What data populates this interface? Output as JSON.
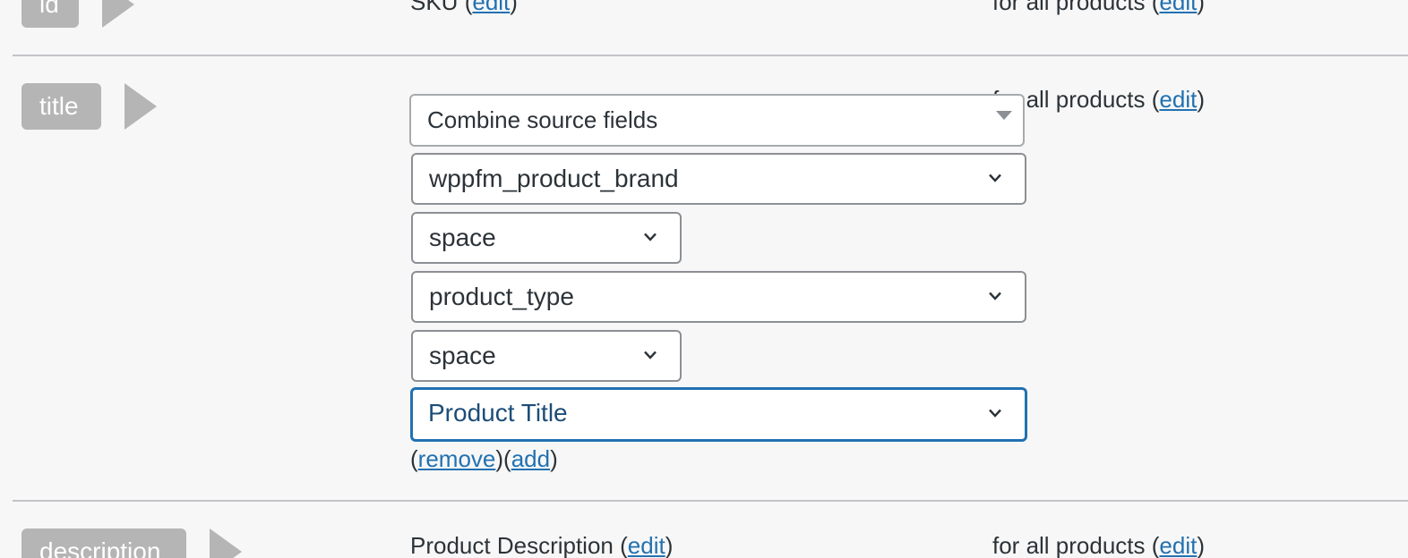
{
  "rows": {
    "id": {
      "tag_label": "id",
      "source_text": "SKU",
      "source_edit": "edit",
      "condition_text": "for all products",
      "condition_edit": "edit"
    },
    "title": {
      "tag_label": "title",
      "condition_text": "for all products",
      "condition_edit": "edit",
      "combine_select": "Combine source fields",
      "fields": [
        {
          "value": "wppfm_product_brand"
        },
        {
          "value": "space"
        },
        {
          "value": "product_type"
        },
        {
          "value": "space"
        },
        {
          "value": "Product Title"
        }
      ],
      "remove_link": "remove",
      "add_link": "add"
    },
    "description": {
      "tag_label": "description",
      "source_text": "Product Description",
      "source_edit": "edit",
      "condition_text": "for all products",
      "condition_edit": "edit"
    }
  },
  "icons": {
    "chevron": "chevron-down-icon",
    "combine_arrow": "triangle-down-icon",
    "tag_arrow": "arrow-right-icon"
  },
  "colors": {
    "link": "#2271b1",
    "focus_border": "#2271b1",
    "tag_bg": "#b5b5b5",
    "page_bg": "#f7f7f7"
  }
}
